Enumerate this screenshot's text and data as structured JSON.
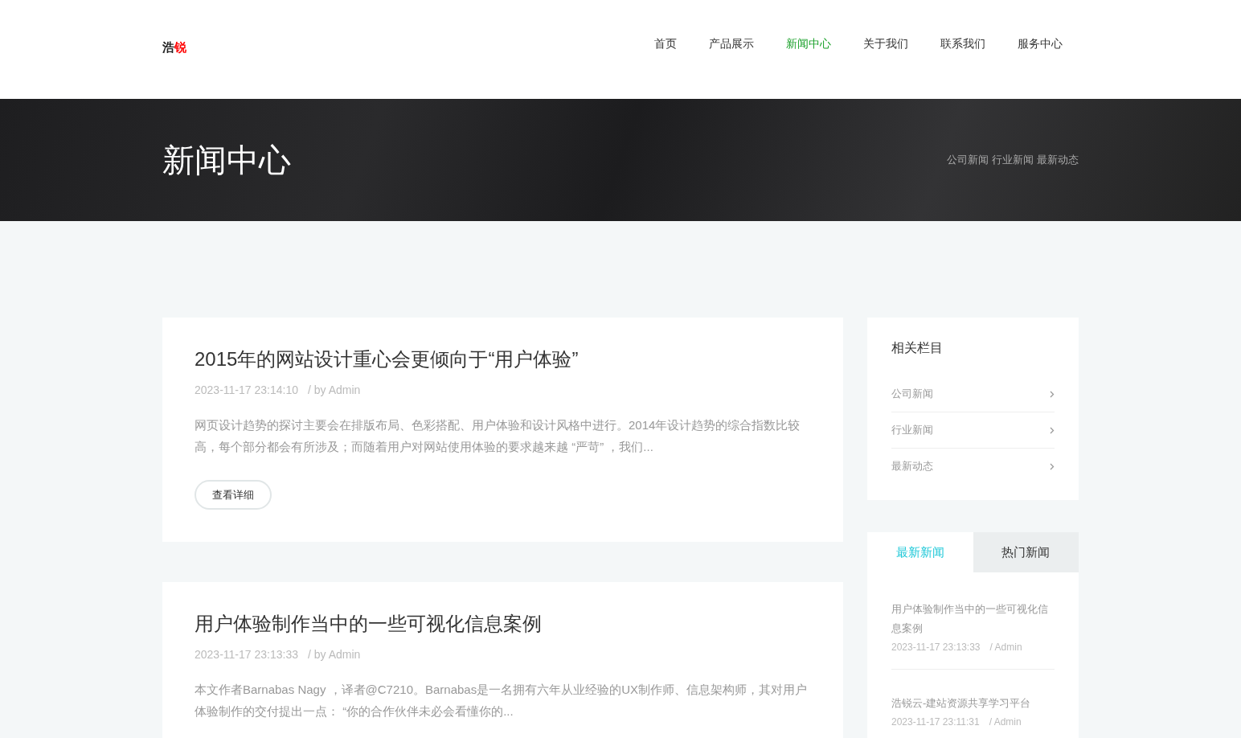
{
  "logo": [
    {
      "text": "浩",
      "color": "#222222"
    },
    {
      "text": "锐",
      "color": "#ff0000"
    }
  ],
  "nav": [
    {
      "label": "首页",
      "selected": false
    },
    {
      "label": "产品展示",
      "selected": false
    },
    {
      "label": "新闻中心",
      "selected": true
    },
    {
      "label": "关于我们",
      "selected": false
    },
    {
      "label": "联系我们",
      "selected": false
    },
    {
      "label": "服务中心",
      "selected": false
    }
  ],
  "banner": {
    "title": "新闻中心",
    "links": [
      "公司新闻",
      "行业新闻",
      "最新动态"
    ]
  },
  "articles": [
    {
      "title": "2015年的网站设计重心会更倾向于“用户体验”",
      "date": "2023-11-17 23:14:10",
      "author": "/  by Admin",
      "summary": "网页设计趋势的探讨主要会在排版布局、色彩搭配、用户体验和设计风格中进行。2014年设计趋势的综合指数比较高，每个部分都会有所涉及；而随着用户对网站使用体验的要求越来越 “严苛” ，我们...",
      "button": "查看详细"
    },
    {
      "title": "用户体验制作当中的一些可视化信息案例",
      "date": "2023-11-17 23:13:33",
      "author": "/  by Admin",
      "summary": "本文作者Barnabas Nagy ，译者@C7210。Barnabas是一名拥有六年从业经验的UX制作师、信息架构师，其对用户体验制作的交付提出一点： “你的合作伙伴未必会看懂你的..."
    }
  ],
  "sidebar": {
    "title": "相关栏目",
    "items": [
      "公司新闻",
      "行业新闻",
      "最新动态"
    ],
    "tabs": [
      {
        "label": "最新新闻",
        "selected": true
      },
      {
        "label": "热门新闻",
        "selected": false
      }
    ],
    "news": [
      {
        "title": "用户体验制作当中的一些可视化信息案例",
        "date": "2023-11-17 23:13:33",
        "author": "/  Admin"
      },
      {
        "title": "浩锐云-建站资源共享学习平台",
        "date": "2023-11-17 23:11:31",
        "author": "/  Admin"
      }
    ]
  }
}
